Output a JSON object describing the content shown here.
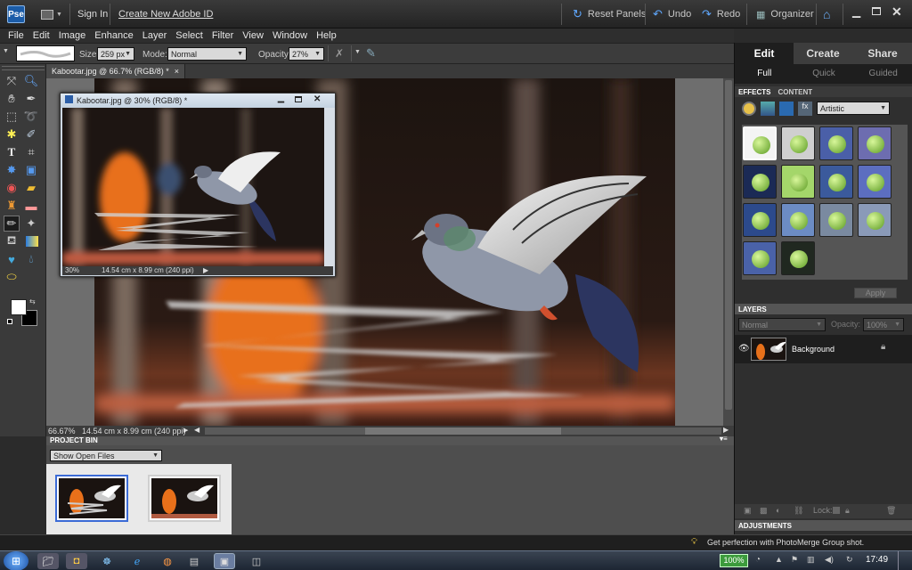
{
  "titlebar": {
    "sign_in": "Sign In",
    "create_id": "Create New Adobe ID",
    "reset_panels": "Reset Panels",
    "undo": "Undo",
    "redo": "Redo",
    "organizer": "Organizer"
  },
  "menu": [
    "File",
    "Edit",
    "Image",
    "Enhance",
    "Layer",
    "Select",
    "Filter",
    "View",
    "Window",
    "Help"
  ],
  "options": {
    "size_label": "Size:",
    "size_value": "259 px",
    "mode_label": "Mode:",
    "mode_value": "Normal",
    "opacity_label": "Opacity:",
    "opacity_value": "27%"
  },
  "doc_tab": {
    "label": "Kabootar.jpg @ 66.7% (RGB/8) *",
    "close": "×"
  },
  "float_window": {
    "title": "Kabootar.jpg @ 30% (RGB/8) *",
    "zoom": "30%",
    "dims": "14.54 cm x 8.99 cm (240 ppi)"
  },
  "status": {
    "zoom": "66.67%",
    "dims": "14.54 cm x 8.99 cm (240 ppi)"
  },
  "project_bin": {
    "title": "PROJECT BIN",
    "filter": "Show Open Files"
  },
  "right_panel": {
    "tabs": [
      "Edit",
      "Create",
      "Share"
    ],
    "subtabs": [
      "Full",
      "Quick",
      "Guided"
    ],
    "effects_tab": "EFFECTS",
    "content_tab": "CONTENT",
    "effects_category": "Artistic",
    "apply": "Apply",
    "layers_title": "LAYERS",
    "blend_mode": "Normal",
    "opacity_label": "Opacity:",
    "opacity_value": "100%",
    "layer_name": "Background",
    "lock_label": "Lock:",
    "adjustments_title": "ADJUSTMENTS"
  },
  "info": {
    "tip": "Get perfection with PhotoMerge Group shot."
  },
  "taskbar": {
    "battery": "100%",
    "time": "17:49"
  },
  "colors": {
    "accent_tab": "#1e1e1e",
    "selection_blue": "#3b6bd6"
  }
}
